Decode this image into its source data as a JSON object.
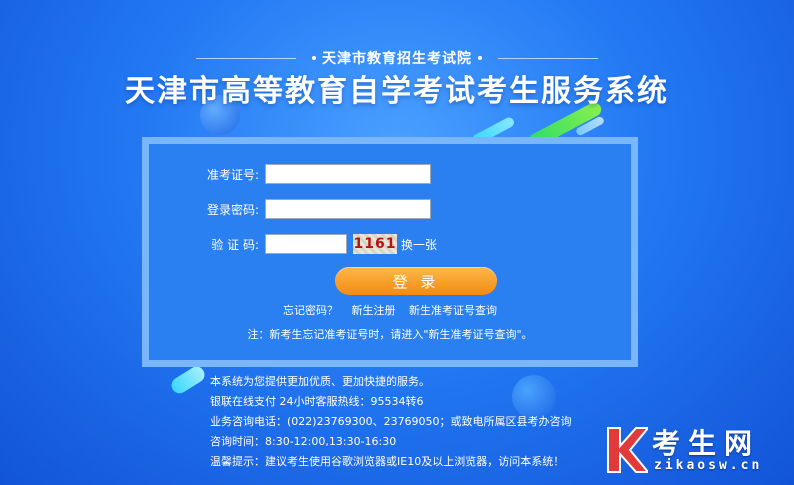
{
  "header": {
    "organization": "天津市教育招生考试院",
    "title": "天津市高等教育自学考试考生服务系统"
  },
  "form": {
    "exam_id_label": "准考证号:",
    "exam_id_value": "",
    "password_label": "登录密码:",
    "password_value": "",
    "captcha_label": "验 证 码:",
    "captcha_value": "",
    "captcha_image_text": "1161",
    "captcha_refresh": "换一张",
    "login_button": "登 录"
  },
  "links": {
    "forgot_password": "忘记密码？",
    "register": "新生注册",
    "lookup_exam_id": "新生准考证号查询"
  },
  "note": "注：新考生忘记准考证号时，请进入\"新生准考证号查询\"。",
  "info": {
    "line1": "本系统为您提供更加优质、更加快捷的服务。",
    "line2": "银联在线支付 24小时客服热线：95534转6",
    "line3": "业务咨询电话：(022)23769300、23769050；或致电所属区县考办咨询",
    "line4": "咨询时间：8:30-12:00,13:30-16:30",
    "line5": "温馨提示：建议考生使用谷歌浏览器或IE10及以上浏览器，访问本系统！"
  },
  "watermark": {
    "name": "考生网",
    "url": "zikaosw.cn"
  },
  "colors": {
    "background": "#2379f3",
    "panel": "#2a7ff1",
    "button": "#f5a12a",
    "captcha_digits": "#bb1111",
    "watermark_k": "#e23a3a"
  }
}
